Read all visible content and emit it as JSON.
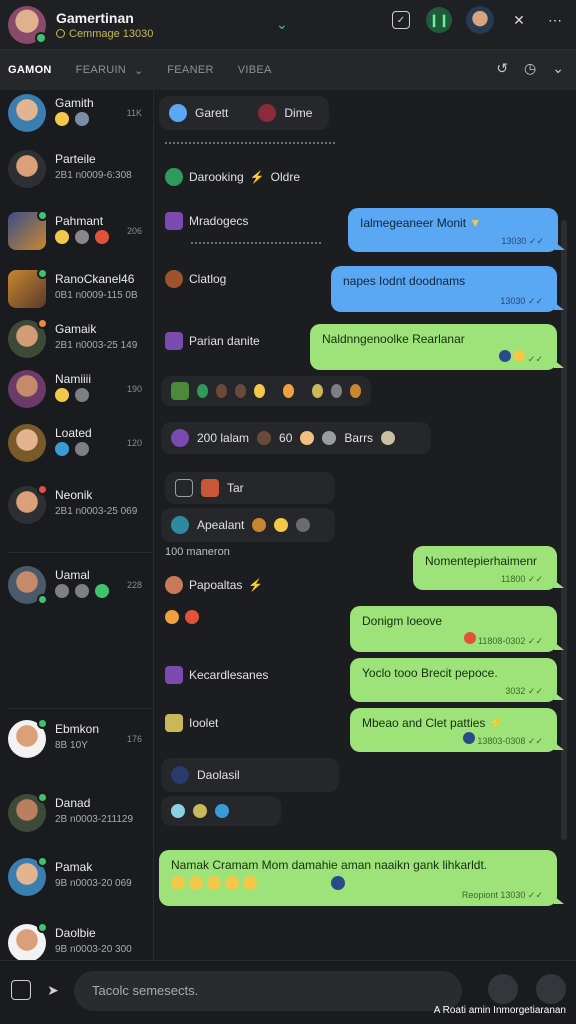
{
  "header": {
    "title": "Gamertinan",
    "subtitle": "Cemmage 13030",
    "expand_icon": "chevron-down-icon",
    "actions": [
      "note-icon",
      "audio-call-icon",
      "profile-avatar",
      "close-icon",
      "more-icon"
    ]
  },
  "tabs": [
    {
      "label": "GAMON",
      "active": true
    },
    {
      "label": "FEARUIN",
      "active": false
    },
    {
      "label": "FEANER",
      "active": false
    },
    {
      "label": "VIBEA",
      "active": false
    }
  ],
  "tab_actions": [
    "share-icon",
    "refresh-icon",
    "chevron-down-icon"
  ],
  "contacts": [
    {
      "name": "Gamith",
      "time": "11K",
      "sub": ""
    },
    {
      "name": "Parteile",
      "sub": "2B1 n0009-6:308",
      "time": ""
    },
    {
      "name": "Pahmant",
      "sub": "",
      "time": "206"
    },
    {
      "name": "RanoCkanel46",
      "sub": "0B1 n0009-115 0B",
      "time": ""
    },
    {
      "name": "Gamaik",
      "sub": "2B1 n0003-25 149",
      "time": ""
    },
    {
      "name": "Namiiii",
      "sub": "",
      "time": "190"
    },
    {
      "name": "Loated",
      "sub": "",
      "time": "120"
    },
    {
      "name": "Neonik",
      "sub": "2B1 n0003-25 069",
      "time": ""
    },
    {
      "name": "Uamal",
      "sub": "",
      "time": "228"
    },
    {
      "name": "Ebmkon",
      "sub": "8B 10Y",
      "time": "176"
    },
    {
      "name": "Danad",
      "sub": "2B n0003-211129",
      "time": ""
    },
    {
      "name": "Pamak",
      "sub": "9B n0003-20 069",
      "time": ""
    },
    {
      "name": "Daolbie",
      "sub": "9B n0003-20 300",
      "time": ""
    }
  ],
  "messages": {
    "m1_a": "Garett",
    "m1_b": "Dime",
    "m2": "Darooking",
    "m2_b": "Oldre",
    "m3_left": "Mradogecs",
    "m3_bubble": "Ialmegeaneer Monit",
    "m3_meta": "13030",
    "m4_left": "Clatlog",
    "m4_bubble": "napes Iodnt doodnams",
    "m4_meta": "13030",
    "m5_left": "Parian danite",
    "m5_bubble": "Naldnngenoolke Rearlanar",
    "m6_text": "200 lalam",
    "m6_mid": "60",
    "m6_tail": "Barrs",
    "m7_chip": "Tar",
    "m8": "Apealant",
    "m8_sub": "100 maneron",
    "m8_bubble": "Nomentepierhaimenr",
    "m8_meta": "11800",
    "m9": "Papoaltas",
    "m9_bubble": "Donigm loeove",
    "m9_meta": "11808-0302",
    "m10": "Kecardlesanes",
    "m10_bubble": "Yoclo tooo Brecit pepoce.",
    "m10_meta": "3032",
    "m11": "Ioolet",
    "m11_bubble": "Mbeao and Clet patties",
    "m11_meta": "13803-0308",
    "m12": "Daolasil",
    "m13_bubble": "Namak Cramam  Mom damahie aman naaikn gank lihkarldt.",
    "m13_meta": "Reopiont 13030"
  },
  "composer": {
    "placeholder": "Tacolc semesects.",
    "footnote": "A Roati amin Inmorgetiaranan"
  }
}
